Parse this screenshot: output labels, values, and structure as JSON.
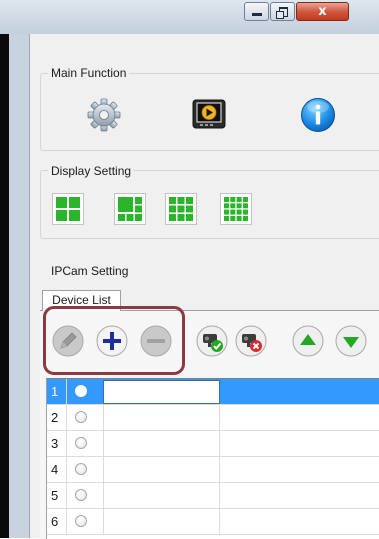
{
  "window": {
    "controls": {
      "minimize_icon": "minimize-icon",
      "maximize_icon": "maximize-icon",
      "close_label": "x",
      "close_color": "#c8432a"
    }
  },
  "main_function": {
    "title": "Main Function",
    "buttons": [
      {
        "icon": "gear-icon",
        "name": "settings"
      },
      {
        "icon": "video-player-icon",
        "name": "playback"
      },
      {
        "icon": "info-icon",
        "name": "about"
      }
    ]
  },
  "display_setting": {
    "title": "Display Setting",
    "layouts": [
      "4-split",
      "6-split",
      "9-split",
      "16-split"
    ],
    "accent": "#2bb52b"
  },
  "ipcam_setting": {
    "title": "IPCam Setting",
    "tab_label": "Device List",
    "toolbar": [
      {
        "icon": "pencil-icon",
        "name": "edit",
        "enabled": false
      },
      {
        "icon": "plus-icon",
        "name": "add",
        "enabled": true
      },
      {
        "icon": "minus-icon",
        "name": "remove",
        "enabled": false
      },
      {
        "icon": "camera-connect-icon",
        "name": "connect"
      },
      {
        "icon": "camera-disconnect-icon",
        "name": "disconnect"
      },
      {
        "icon": "arrow-up-icon",
        "name": "move-up"
      },
      {
        "icon": "arrow-down-icon",
        "name": "move-down"
      }
    ],
    "highlight_color": "#8b3a3f",
    "rows": [
      {
        "num": "1",
        "selected": true
      },
      {
        "num": "2"
      },
      {
        "num": "3"
      },
      {
        "num": "4"
      },
      {
        "num": "5"
      },
      {
        "num": "6"
      }
    ],
    "selection_color": "#3399ff"
  }
}
